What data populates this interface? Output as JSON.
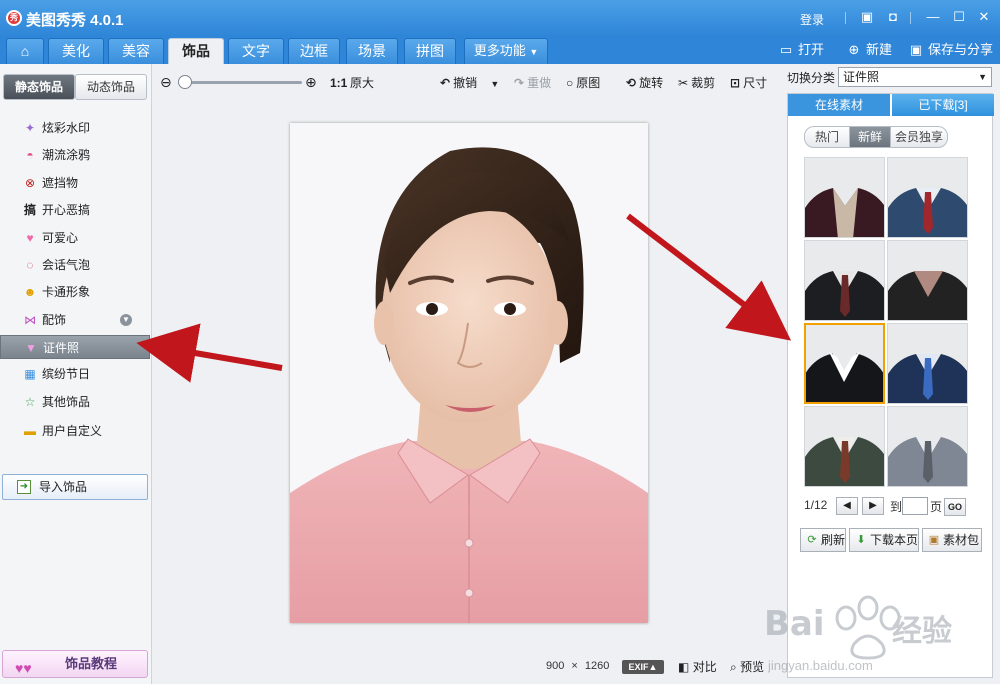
{
  "app": {
    "title": "美图秀秀 4.0.1",
    "logo_text": "秀",
    "login": "登录"
  },
  "window_controls": {
    "chat": "chat-icon",
    "skin": "skin-icon",
    "minimize": "minimize-icon",
    "maximize": "maximize-icon",
    "close": "close-icon"
  },
  "tabs": [
    {
      "label": "美化"
    },
    {
      "label": "美容"
    },
    {
      "label": "饰品"
    },
    {
      "label": "文字"
    },
    {
      "label": "边框"
    },
    {
      "label": "场景"
    },
    {
      "label": "拼图"
    },
    {
      "label": "更多功能"
    }
  ],
  "header_actions": {
    "open": "打开",
    "new": "新建",
    "save_share": "保存与分享"
  },
  "left": {
    "subtabs": [
      "静态饰品",
      "动态饰品"
    ],
    "categories": [
      {
        "label": "炫彩水印",
        "icon": "sparkle-icon"
      },
      {
        "label": "潮流涂鸦",
        "icon": "lips-icon"
      },
      {
        "label": "遮挡物",
        "icon": "mask-icon"
      },
      {
        "label": "开心恶搞",
        "icon": "funny-icon"
      },
      {
        "label": "可爱心",
        "icon": "heart-icon"
      },
      {
        "label": "会话气泡",
        "icon": "bubble-icon"
      },
      {
        "label": "卡通形象",
        "icon": "cartoon-icon"
      },
      {
        "label": "配饰",
        "icon": "bow-icon"
      },
      {
        "label": "证件照",
        "icon": "shirt-icon"
      },
      {
        "label": "缤纷节日",
        "icon": "gift-icon"
      },
      {
        "label": "其他饰品",
        "icon": "star-icon"
      },
      {
        "label": "用户自定义",
        "icon": "folder-icon"
      }
    ],
    "import_label": "导入饰品",
    "tutorial_label": "饰品教程"
  },
  "toolbar": {
    "zoom_ratio": "1:1",
    "original_size": "原大",
    "zoom_level": 0,
    "undo": "撤销",
    "redo": "重做",
    "original": "原图",
    "rotate": "旋转",
    "crop": "裁剪",
    "resize": "尺寸"
  },
  "image_info": {
    "width": "900",
    "times": "×",
    "height": "1260",
    "exif": "EXIF▲"
  },
  "footer_actions": {
    "compare": "对比",
    "preview": "预览"
  },
  "right": {
    "switch_label": "切换分类",
    "category": "证件照",
    "tabs": [
      "在线素材",
      "已下载[3]"
    ],
    "filters": [
      "热门",
      "新鲜",
      "会员独享"
    ],
    "thumbnails": [
      {
        "name": "suit-burgundy"
      },
      {
        "name": "suit-blue-red-tie"
      },
      {
        "name": "suit-black-tie"
      },
      {
        "name": "suit-black-floral"
      },
      {
        "name": "suit-black-white-collar"
      },
      {
        "name": "suit-navy-blue-tie"
      },
      {
        "name": "suit-green-tie"
      },
      {
        "name": "suit-grey"
      }
    ],
    "pager": {
      "current": "1/12",
      "to": "到",
      "page": "页",
      "go": "GO"
    },
    "buttons": {
      "refresh": "刷新",
      "download_page": "下载本页",
      "package": "素材包"
    }
  },
  "watermark": {
    "brand": "Bai",
    "brand_tail": "经验",
    "url": "jingyan.baidu.com"
  },
  "colors": {
    "title_bar": "#3a90dc",
    "accent_orange": "#f0a000",
    "arrow_red": "#c0161c"
  }
}
